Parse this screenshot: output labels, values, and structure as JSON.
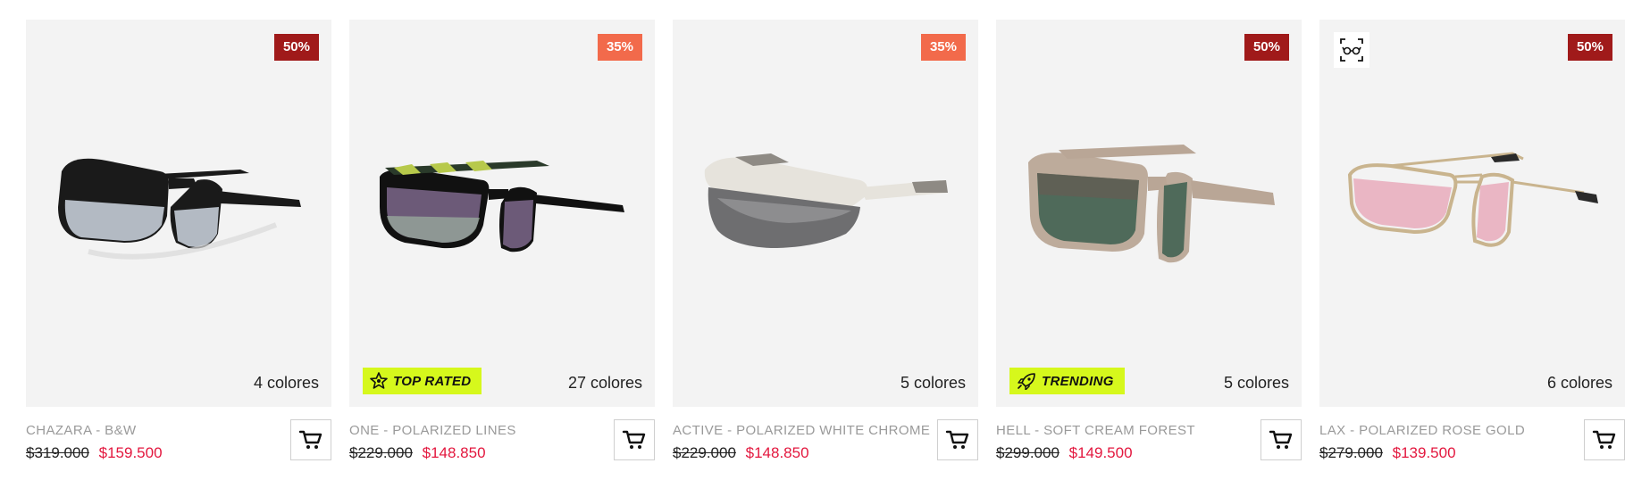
{
  "products": [
    {
      "name": "CHAZARA - B&W",
      "discount": "50%",
      "discount_tone": "dark",
      "colors": "4 colores",
      "old_price": "$319.000",
      "new_price": "$159.500",
      "tag": null,
      "lens_color": "#c4ccd6",
      "frame_color": "#1a1a1a"
    },
    {
      "name": "ONE - POLARIZED LINES",
      "discount": "35%",
      "discount_tone": "light",
      "colors": "27 colores",
      "old_price": "$229.000",
      "new_price": "$148.850",
      "tag": "TOP RATED",
      "lens_color": "#6c5a78",
      "frame_color": "#111111"
    },
    {
      "name": "ACTIVE - POLARIZED WHITE CHROME",
      "discount": "35%",
      "discount_tone": "light",
      "colors": "5 colores",
      "old_price": "$229.000",
      "new_price": "$148.850",
      "tag": null,
      "lens_color": "#6e6e70",
      "frame_color": "#e6e3dc"
    },
    {
      "name": "HELL - SOFT CREAM FOREST",
      "discount": "50%",
      "discount_tone": "dark",
      "colors": "5 colores",
      "old_price": "$299.000",
      "new_price": "$149.500",
      "tag": "TRENDING",
      "lens_color": "#4f6a5a",
      "frame_color": "#b9a696"
    },
    {
      "name": "LAX - POLARIZED ROSE GOLD",
      "discount": "50%",
      "discount_tone": "dark",
      "colors": "6 colores",
      "old_price": "$279.000",
      "new_price": "$139.500",
      "tag": null,
      "lens_color": "#eab6c4",
      "frame_color": "#c9b48e"
    }
  ],
  "icons": {
    "cart": "shopping-cart-icon",
    "try_on": "virtual-try-on-glasses-icon",
    "top_rated": "star-badge-icon",
    "trending": "rocket-icon"
  },
  "colors": {
    "discount_dark": "#a01a1a",
    "discount_light": "#f26a4b",
    "tag_background": "#d6f81c",
    "sale_price": "#e3173e"
  }
}
